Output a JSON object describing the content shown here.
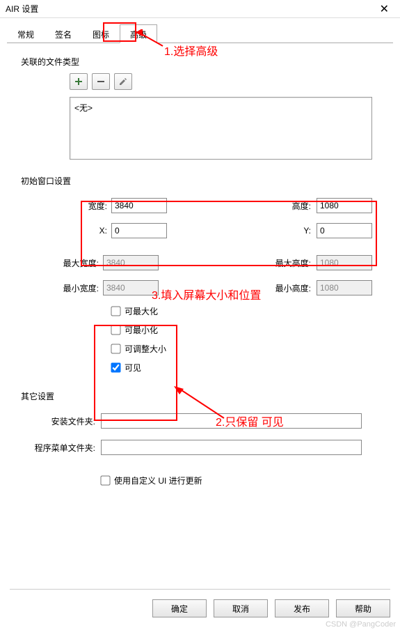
{
  "window": {
    "title": "AIR 设置",
    "close": "✕"
  },
  "tabs": [
    "常规",
    "签名",
    "图标",
    "高级"
  ],
  "active_tab_index": 3,
  "sections": {
    "filetypes": {
      "label": "关联的文件类型",
      "empty_text": "<无>"
    },
    "initwin": {
      "label": "初始窗口设置",
      "width_label": "宽度:",
      "width_value": "3840",
      "height_label": "高度:",
      "height_value": "1080",
      "x_label": "X:",
      "x_value": "0",
      "y_label": "Y:",
      "y_value": "0",
      "maxw_label": "最大宽度:",
      "maxw_value": "3840",
      "maxh_label": "最大高度:",
      "maxh_value": "1080",
      "minw_label": "最小宽度:",
      "minw_value": "3840",
      "minh_label": "最小高度:",
      "minh_value": "1080",
      "cb_max": "可最大化",
      "cb_min": "可最小化",
      "cb_resize": "可调整大小",
      "cb_visible": "可见"
    },
    "other": {
      "label": "其它设置",
      "install_dir": "安装文件夹:",
      "menu_dir": "程序菜单文件夹:",
      "custom_ui": "使用自定义 UI 进行更新"
    }
  },
  "buttons": {
    "ok": "确定",
    "cancel": "取消",
    "publish": "发布",
    "help": "帮助"
  },
  "annotations": {
    "a1": "1.选择高级",
    "a2": "2.只保留 可见",
    "a3": "3.填入屏幕大小和位置"
  },
  "icons": {
    "add": "plus-icon",
    "remove": "minus-icon",
    "edit": "pencil-icon"
  },
  "watermark": "CSDN @PangCoder"
}
